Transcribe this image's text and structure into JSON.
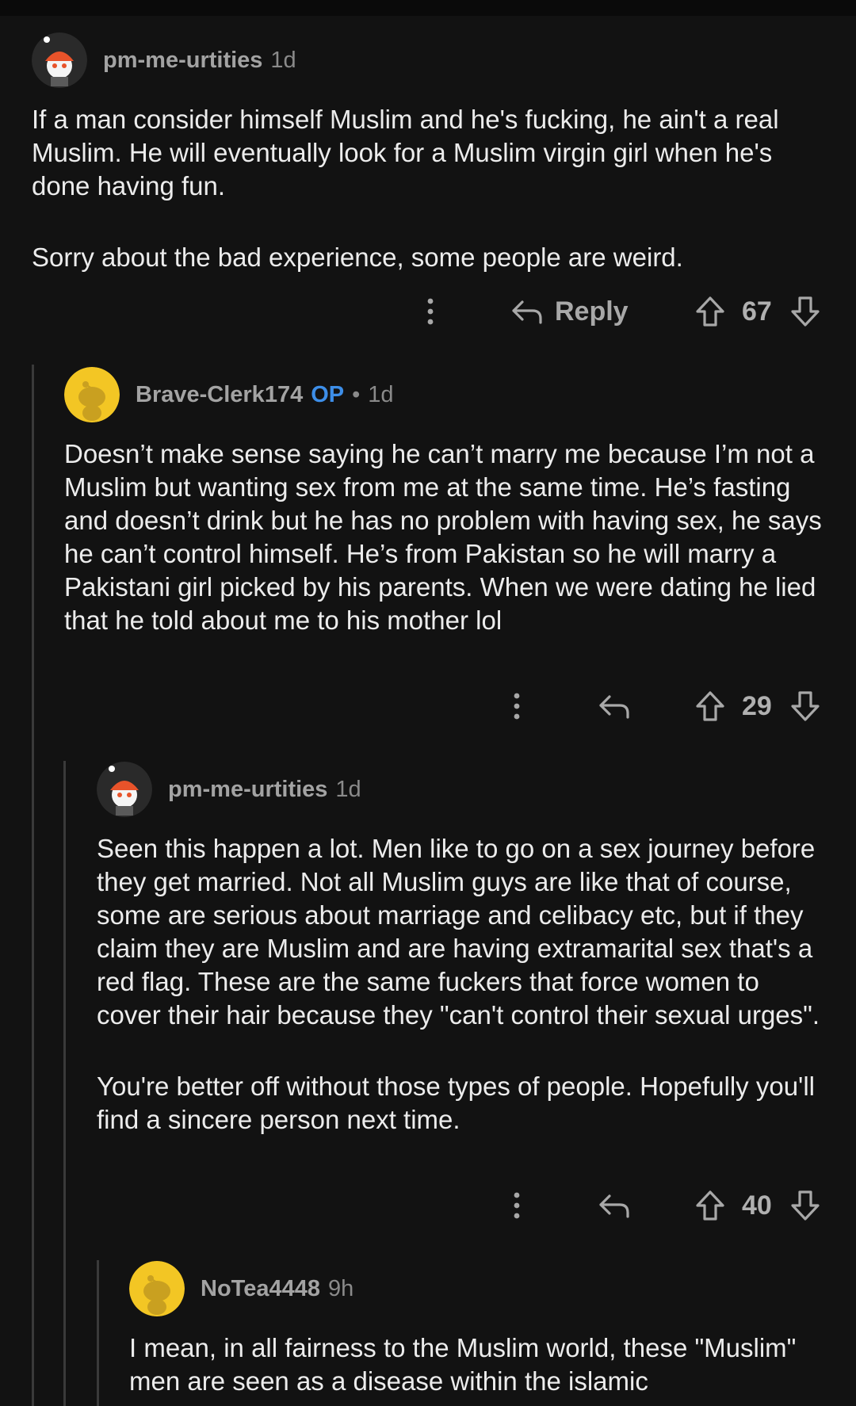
{
  "comments": [
    {
      "username": "pm-me-urtities",
      "time": "1d",
      "paragraphs": [
        "If a man consider himself Muslim and he's fucking, he ain't a real Muslim. He will eventually look for a Muslim virgin girl when he's done having fun.",
        "Sorry about the bad experience, some people are weird."
      ],
      "reply_label": "Reply",
      "votes": "67",
      "avatar_color": "#e8532a"
    },
    {
      "username": "Brave-Clerk174",
      "op_badge": "OP",
      "separator": "•",
      "time": "1d",
      "paragraphs": [
        "Doesn’t make sense saying he can’t marry me because I’m not a Muslim but wanting sex from me at the same time. He’s fasting and doesn’t drink but he has no problem with having sex, he says he can’t control himself. He’s from Pakistan so he will marry a Pakistani girl picked by his parents. When we were dating he lied that he told about me to his mother lol"
      ],
      "votes": "29",
      "avatar_color": "#f3c624"
    },
    {
      "username": "pm-me-urtities",
      "time": "1d",
      "paragraphs": [
        "Seen this happen a lot. Men like to go on a sex journey before they get married. Not all Muslim guys are like that of course, some are serious about marriage and celibacy etc, but if they claim they are Muslim and are having extramarital sex that's a red flag. These are the same fuckers that force women to cover their hair because they \"can't control their sexual urges\".",
        "You're better off without those types of people. Hopefully you'll find a sincere person next time."
      ],
      "votes": "40",
      "avatar_color": "#e8532a"
    },
    {
      "username": "NoTea4448",
      "time": "9h",
      "paragraphs": [
        "I mean, in all fairness to the Muslim world, these \"Muslim\" men are seen as a disease within the islamic"
      ],
      "avatar_color": "#f3c624"
    }
  ],
  "colors": {
    "background": "#121212",
    "op_badge": "#3d8ee8",
    "username": "#a3a3a3",
    "text": "#ececec"
  }
}
